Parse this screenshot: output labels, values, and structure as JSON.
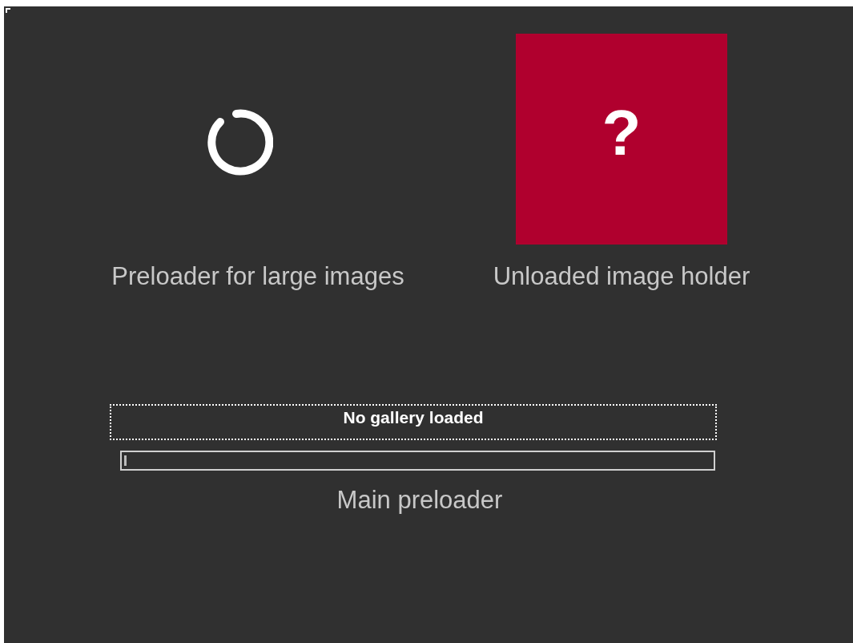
{
  "preloader": {
    "label": "Preloader for large images"
  },
  "image_holder": {
    "glyph": "?",
    "label": "Unloaded image holder",
    "color": "#b0002e"
  },
  "main_preloader": {
    "status": "No gallery loaded",
    "level": 0.005,
    "label": "Main preloader"
  }
}
